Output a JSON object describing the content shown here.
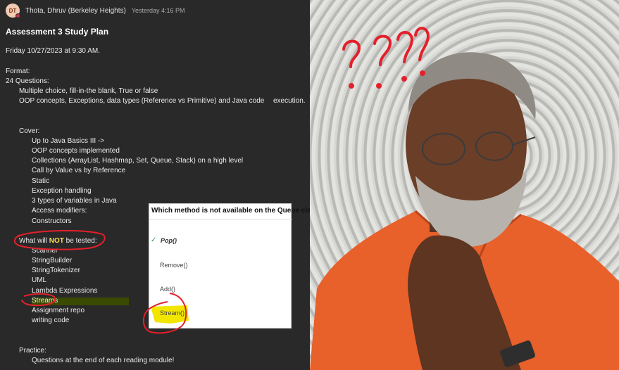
{
  "message": {
    "avatar_initials": "DT",
    "sender": "Thota, Dhruv (Berkeley Heights)",
    "timestamp": "Yesterday 4:16 PM",
    "title": "Assessment 3 Study Plan",
    "date_line": "Friday 10/27/2023 at 9:30 AM.",
    "format_label": "Format:",
    "questions_label": "24 Questions:",
    "format_items": [
      "Multiple choice, fill-in-the blank, True or false",
      "OOP concepts, Exceptions, data types (Reference vs Primitive) and Java code",
      "execution."
    ],
    "cover_label": "Cover:",
    "cover_items": [
      "Up to Java Basics III ->",
      "OOP concepts implemented",
      "Collections (ArrayList, Hashmap, Set, Queue, Stack) on a high level",
      "Call by Value vs by Reference",
      "Static",
      "Exception handling",
      "3 types of variables in Java",
      "Access modifiers:",
      "Constructors"
    ],
    "not_tested": {
      "prefix": "What will ",
      "emphasis": "NOT",
      "suffix": " be tested:"
    },
    "not_tested_items": [
      "Scanner",
      "StringBuilder",
      "StringTokenizer",
      "UML",
      "Lambda Expressions",
      "Streams",
      "Assignment repo",
      "writing code"
    ],
    "practice_label": "Practice:",
    "practice_item": "Questions at the end of each reading module!"
  },
  "quiz": {
    "question": "Which method is not available on the Queue class?",
    "options": [
      "Pop()",
      "Remove()",
      "Add()",
      "Stream()"
    ],
    "selected_index": 0,
    "check_glyph": "✓"
  },
  "video": {
    "annotation": "? ? ? ?"
  },
  "colors": {
    "chat_bg": "#292929",
    "annotation_red": "#e3202b",
    "highlight_yellow": "#f2e600",
    "emphasis_yellow": "#ffdd57",
    "shirt_orange": "#e8602a"
  }
}
